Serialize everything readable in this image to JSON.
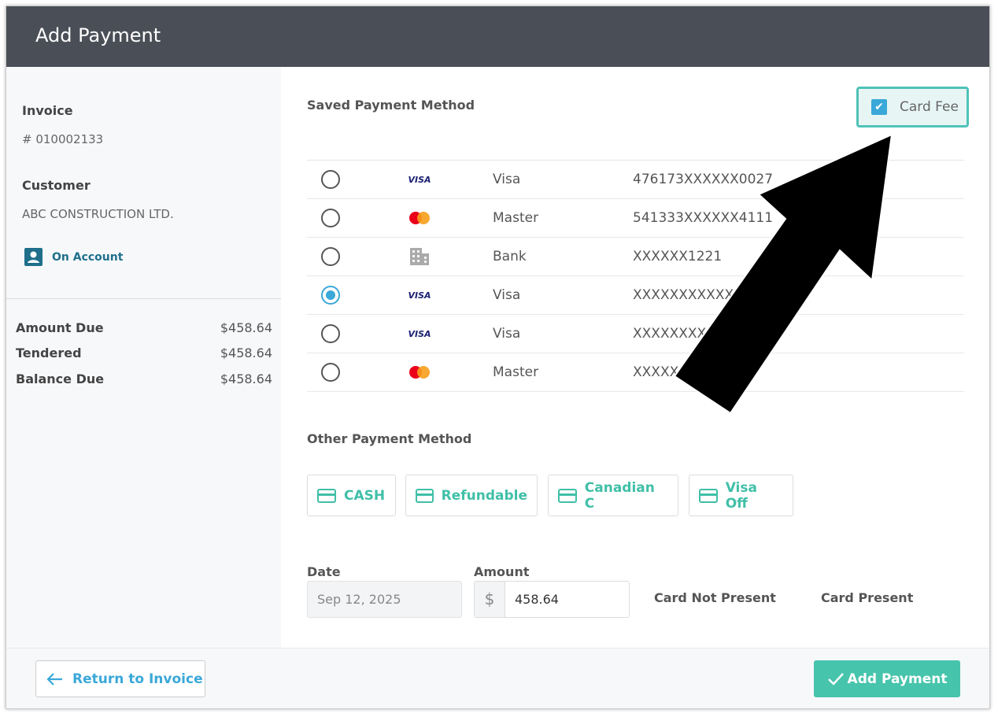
{
  "header": {
    "title": "Add Payment"
  },
  "sidebar": {
    "invoice_label": "Invoice",
    "invoice_number": "# 010002133",
    "customer_label": "Customer",
    "customer_name": "ABC CONSTRUCTION LTD.",
    "on_account": "On Account",
    "summary": [
      {
        "label": "Amount Due",
        "value": "$458.64"
      },
      {
        "label": "Tendered",
        "value": "$458.64"
      },
      {
        "label": "Balance Due",
        "value": "$458.64"
      }
    ]
  },
  "main": {
    "saved_title": "Saved Payment Method",
    "card_fee": {
      "label": "Card Fee",
      "checked": true
    },
    "saved_methods": [
      {
        "brand": "visa",
        "brand_text": "VISA",
        "name": "Visa",
        "number": "476173XXXXXX0027",
        "selected": false
      },
      {
        "brand": "mastercard",
        "brand_text": "",
        "name": "Master",
        "number": "541333XXXXXX4111",
        "selected": false
      },
      {
        "brand": "bank",
        "brand_text": "",
        "name": "Bank",
        "number": "XXXXXX1221",
        "selected": false
      },
      {
        "brand": "visa",
        "brand_text": "VISA",
        "name": "Visa",
        "number": "XXXXXXXXXXXX",
        "selected": true
      },
      {
        "brand": "visa",
        "brand_text": "VISA",
        "name": "Visa",
        "number": "XXXXXXXX",
        "selected": false
      },
      {
        "brand": "mastercard",
        "brand_text": "",
        "name": "Master",
        "number": "XXXXX",
        "selected": false
      }
    ],
    "other_title": "Other Payment Method",
    "other_methods": [
      "CASH",
      "Refundable",
      "Canadian C",
      "Visa Off"
    ],
    "date_label": "Date",
    "date_value": "Sep 12, 2025",
    "amount_label": "Amount",
    "currency": "$",
    "amount_value": "458.64",
    "card_not_present": "Card Not Present",
    "card_present": "Card Present"
  },
  "footer": {
    "return_label": "Return to Invoice",
    "add_label": "Add Payment"
  },
  "colors": {
    "header": "#4a4f57",
    "accent": "#47c4ac",
    "link": "#3aa8d8",
    "on_account": "#1f6f8b"
  }
}
